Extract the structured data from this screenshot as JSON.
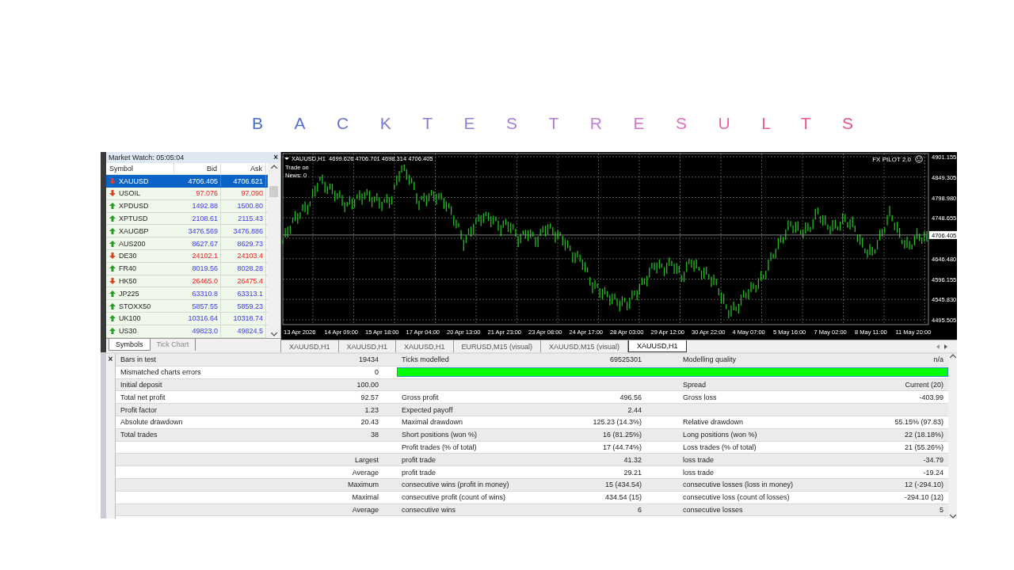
{
  "title": "BACKTEST RESULTS",
  "market_watch": {
    "title": "Market Watch: 05:05:04",
    "close_glyph": "×",
    "columns": [
      "Symbol",
      "Bid",
      "Ask"
    ],
    "symbols": [
      {
        "symbol": "XAUUSD",
        "bid": "4706.405",
        "ask": "4706.621",
        "kind": "down",
        "selected": true
      },
      {
        "symbol": "USOIL",
        "bid": "97.076",
        "ask": "97.090",
        "kind": "down",
        "selected": false
      },
      {
        "symbol": "XPDUSD",
        "bid": "1492.88",
        "ask": "1500.80",
        "kind": "up",
        "selected": false
      },
      {
        "symbol": "XPTUSD",
        "bid": "2108.61",
        "ask": "2115.43",
        "kind": "up",
        "selected": false
      },
      {
        "symbol": "XAUGBP",
        "bid": "3476.569",
        "ask": "3476.886",
        "kind": "up",
        "selected": false
      },
      {
        "symbol": "AUS200",
        "bid": "8627.67",
        "ask": "8629.73",
        "kind": "up",
        "selected": false
      },
      {
        "symbol": "DE30",
        "bid": "24102.1",
        "ask": "24103.4",
        "kind": "down",
        "selected": false
      },
      {
        "symbol": "FR40",
        "bid": "8019.56",
        "ask": "8028.28",
        "kind": "up",
        "selected": false
      },
      {
        "symbol": "HK50",
        "bid": "26465.0",
        "ask": "26475.4",
        "kind": "down",
        "selected": false
      },
      {
        "symbol": "JP225",
        "bid": "63310.8",
        "ask": "63313.1",
        "kind": "up",
        "selected": false
      },
      {
        "symbol": "STOXX50",
        "bid": "5857.55",
        "ask": "5859.23",
        "kind": "up",
        "selected": false
      },
      {
        "symbol": "UK100",
        "bid": "10316.64",
        "ask": "10318.74",
        "kind": "up",
        "selected": false
      },
      {
        "symbol": "US30",
        "bid": "49823.0",
        "ask": "49824.5",
        "kind": "up",
        "selected": false
      }
    ],
    "tabs": [
      {
        "label": "Symbols",
        "selected": true
      },
      {
        "label": "Tick Chart",
        "selected": false
      }
    ]
  },
  "chart": {
    "symbol_line": "XAUUSD,H1  4699.626 4706.701 4698.314 4706.405",
    "notes": [
      "Trade on",
      "News: 0"
    ],
    "expert": "FX PILOT 2.0",
    "price_labels": [
      "4901.155",
      "4849.305",
      "4798.980",
      "4748.655",
      "4646.480",
      "4596.155",
      "4545.830",
      "4495.505"
    ],
    "current_price": "4706.405",
    "time_labels": [
      "13 Apr 2026",
      "14 Apr 09:00",
      "15 Apr 18:00",
      "17 Apr 04:00",
      "20 Apr 13:00",
      "21 Apr 23:00",
      "23 Apr 08:00",
      "24 Apr 17:00",
      "28 Apr 03:00",
      "29 Apr 12:00",
      "30 Apr 22:00",
      "4 May 07:00",
      "5 May 16:00",
      "7 May 02:00",
      "8 May 11:00",
      "11 May 20:00"
    ]
  },
  "chart_tabs": [
    {
      "label": "XAUUSD,H1",
      "selected": false
    },
    {
      "label": "XAUUSD,H1",
      "selected": false
    },
    {
      "label": "XAUUSD,H1",
      "selected": false
    },
    {
      "label": "EURUSD,M15 (visual)",
      "selected": false
    },
    {
      "label": "XAUUSD,M15 (visual)",
      "selected": false
    },
    {
      "label": "XAUUSD,H1",
      "selected": true
    }
  ],
  "report": {
    "close_glyph": "×",
    "rows": [
      {
        "kind": "text",
        "column_1": "Bars in test",
        "column_2": "19434",
        "column_3": "Ticks modelled",
        "column_4": "69525301",
        "column_5": "Modelling quality",
        "column_6": "n/a"
      },
      {
        "kind": "quality_bar",
        "column_1": "Mismatched charts errors",
        "column_2": "0",
        "level": 1
      },
      {
        "kind": "text",
        "column_1": "Initial deposit",
        "column_2": "100.00",
        "column_5": "Spread",
        "column_6": "Current (20)"
      },
      {
        "kind": "text",
        "column_1": "Total net profit",
        "column_2": "92.57",
        "column_3": "Gross profit",
        "column_4": "496.56",
        "column_5": "Gross loss",
        "column_6": "-403.99"
      },
      {
        "kind": "text",
        "column_1": "Profit factor",
        "column_2": "1.23",
        "column_3": "Expected payoff",
        "column_4": "2.44"
      },
      {
        "kind": "text",
        "column_1": "Absolute drawdown",
        "column_2": "20.43",
        "column_3": "Maximal drawdown",
        "column_4": "125.23  (14.3%)",
        "column_5": "Relative drawdown",
        "column_6": "55.15% (97.83)"
      },
      {
        "kind": "text",
        "column_1": "Total trades",
        "column_2": "38",
        "column_3": "Short positions (won %)",
        "column_4": "16 (81.25%)",
        "column_5": "Long positions (won %)",
        "column_6": "22 (18.18%)"
      },
      {
        "kind": "text",
        "column_3": "Profit trades (% of total)",
        "column_4": "17 (44.74%)",
        "column_5": "Loss trades (% of total)",
        "column_6": "21 (55.26%)"
      },
      {
        "kind": "text",
        "column_2": "Largest",
        "column_3": "profit trade",
        "column_4": "41.32",
        "column_5": "loss trade",
        "column_6": "-34.79"
      },
      {
        "kind": "text",
        "column_2": "Average",
        "column_3": "profit trade",
        "column_4": "29.21",
        "column_5": "loss trade",
        "column_6": "-19.24"
      },
      {
        "kind": "text",
        "column_2": "Maximum",
        "column_3": "consecutive wins (profit in money)",
        "column_4": "15 (434.54)",
        "column_5": "consecutive losses (loss in money)",
        "column_6": "12 (-294.10)"
      },
      {
        "kind": "text",
        "column_2": "Maximal",
        "column_3": "consecutive profit (count of wins)",
        "column_4": "434.54 (15)",
        "column_5": "consecutive loss (count of losses)",
        "column_6": "-294.10 (12)"
      },
      {
        "kind": "text",
        "column_2": "Average",
        "column_3": "consecutive wins",
        "column_4": "6",
        "column_5": "consecutive losses",
        "column_6": "5"
      }
    ]
  }
}
